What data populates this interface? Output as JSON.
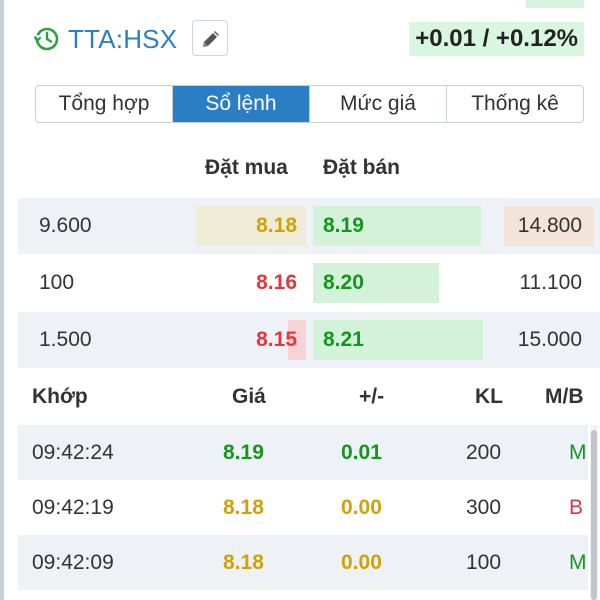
{
  "header": {
    "symbol": "TTA:HSX",
    "change": "+0.01 / +0.12%",
    "clock_icon": "clock-refresh-icon",
    "edit_icon": "pencil-icon"
  },
  "tabs": [
    {
      "label": "Tổng hợp",
      "active": false
    },
    {
      "label": "Sổ lệnh",
      "active": true
    },
    {
      "label": "Mức giá",
      "active": false
    },
    {
      "label": "Thống kê",
      "active": false
    }
  ],
  "order_book": {
    "bid_header": "Đặt mua",
    "ask_header": "Đặt bán",
    "rows": [
      {
        "bid_volume": "9.600",
        "bid_price": "8.18",
        "bid_color": "yellow",
        "ask_price": "8.19",
        "ask_volume": "14.800"
      },
      {
        "bid_volume": "100",
        "bid_price": "8.16",
        "bid_color": "red",
        "ask_price": "8.20",
        "ask_volume": "11.100"
      },
      {
        "bid_volume": "1.500",
        "bid_price": "8.15",
        "bid_color": "red",
        "ask_price": "8.21",
        "ask_volume": "15.000"
      }
    ]
  },
  "trades": {
    "headers": {
      "time": "Khớp",
      "price": "Giá",
      "change": "+/-",
      "volume": "KL",
      "side": "M/B"
    },
    "rows": [
      {
        "time": "09:42:24",
        "price": "8.19",
        "change": "0.01",
        "volume": "200",
        "side": "M",
        "color": "green"
      },
      {
        "time": "09:42:19",
        "price": "8.18",
        "change": "0.00",
        "volume": "300",
        "side": "B",
        "color": "yellow"
      },
      {
        "time": "09:42:09",
        "price": "8.18",
        "change": "0.00",
        "volume": "100",
        "side": "M",
        "color": "yellow"
      }
    ]
  },
  "colors": {
    "accent": "#2b7dc4",
    "up": "#14961f",
    "down": "#e0383e",
    "reference": "#d0a20a",
    "up_bg": "#d3f2d9"
  }
}
